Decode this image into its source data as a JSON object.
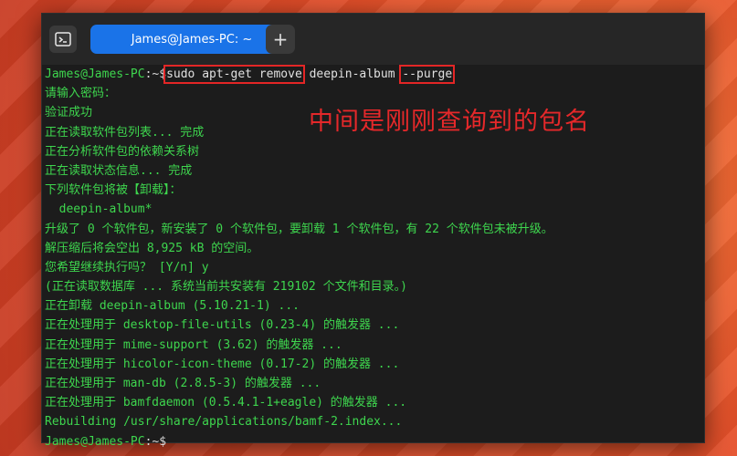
{
  "tab": {
    "title": "James@James-PC: ~",
    "close_icon": "×",
    "new_tab_icon": "+"
  },
  "prompt": {
    "user_host": "James@James-PC",
    "sep": ":",
    "path": "~",
    "dollar": "$"
  },
  "command": {
    "part1": "sudo apt-get remove",
    "part2": " deepin-album ",
    "part3": "--purge"
  },
  "annotation": "中间是刚刚查询到的包名",
  "output_lines": [
    "请输入密码：",
    "验证成功",
    "正在读取软件包列表... 完成",
    "正在分析软件包的依赖关系树",
    "正在读取状态信息... 完成",
    "下列软件包将被【卸载】：",
    "  deepin-album*",
    "升级了 0 个软件包，新安装了 0 个软件包，要卸载 1 个软件包，有 22 个软件包未被升级。",
    "解压缩后将会空出 8,925 kB 的空间。",
    "您希望继续执行吗？ [Y/n] y",
    "(正在读取数据库 ... 系统当前共安装有 219102 个文件和目录。)",
    "正在卸载 deepin-album (5.10.21-1) ...",
    "正在处理用于 desktop-file-utils (0.23-4) 的触发器 ...",
    "正在处理用于 mime-support (3.62) 的触发器 ...",
    "正在处理用于 hicolor-icon-theme (0.17-2) 的触发器 ...",
    "正在处理用于 man-db (2.8.5-3) 的触发器 ...",
    "正在处理用于 bamfdaemon (0.5.4.1-1+eagle) 的触发器 ...",
    "Rebuilding /usr/share/applications/bamf-2.index..."
  ],
  "colors": {
    "terminal_text": "#3ed64e",
    "highlight_box": "#e32626",
    "tab_active": "#1a73e8"
  }
}
